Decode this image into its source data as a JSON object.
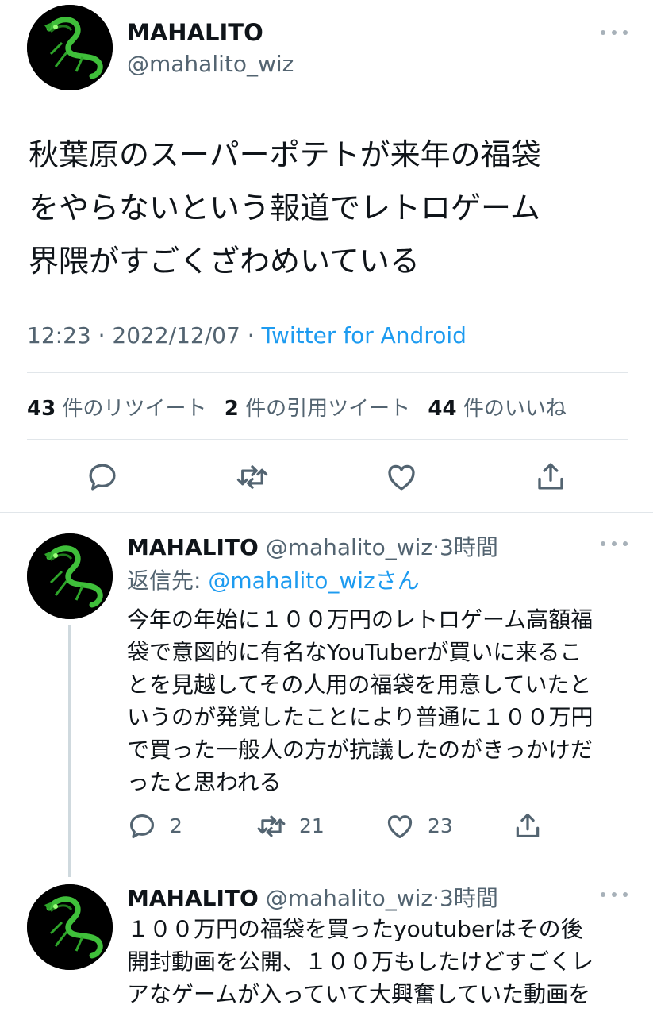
{
  "main_tweet": {
    "display_name": "MAHALITO",
    "handle": "@mahalito_wiz",
    "text_lines": [
      "秋葉原のスーパーポテトが来年の福袋",
      "をやらないという報道でレトロゲーム",
      "界隈がすごくざわめいている"
    ],
    "time": "12:23",
    "sep1": " · ",
    "date": "2022/12/07",
    "sep2": " · ",
    "client": "Twitter for Android",
    "stats": {
      "retweets_count": "43",
      "retweets_label": "件のリツイート",
      "quotes_count": "2",
      "quotes_label": "件の引用ツイート",
      "likes_count": "44",
      "likes_label": "件のいいね"
    }
  },
  "replies": [
    {
      "display_name": "MAHALITO",
      "handle": "@mahalito_wiz",
      "time_sep": "·",
      "time": "3時間",
      "replying_label": "返信先:",
      "replying_handle": "@mahalito_wiz",
      "replying_suffix": "さん",
      "text_lines": [
        "今年の年始に１００万円のレトロゲーム高額福",
        "袋で意図的に有名なYouTuberが買いに来るこ",
        "とを見越してその人用の福袋を用意していたと",
        "いうのが発覚したことにより普通に１００万円",
        "で買った一般人の方が抗議したのがきっかけだ",
        "ったと思われる"
      ],
      "reply_count": "2",
      "retweet_count": "21",
      "like_count": "23"
    },
    {
      "display_name": "MAHALITO",
      "handle": "@mahalito_wiz",
      "time_sep": "·",
      "time": "3時間",
      "text_lines": [
        "１００万円の福袋を買ったyoutuberはその後",
        "開封動画を公開、１００万もしたけどすごくレ",
        "アなゲームが入っていて大興奮していた動画を"
      ]
    }
  ],
  "colors": {
    "text": "#0f1419",
    "secondary": "#536471",
    "link": "#1d9bf0",
    "divider": "#e1e6ea",
    "thread_line": "#cfd9de"
  },
  "icons": [
    "more-icon",
    "reply-icon",
    "retweet-icon",
    "like-icon",
    "share-icon",
    "dragon-avatar"
  ]
}
